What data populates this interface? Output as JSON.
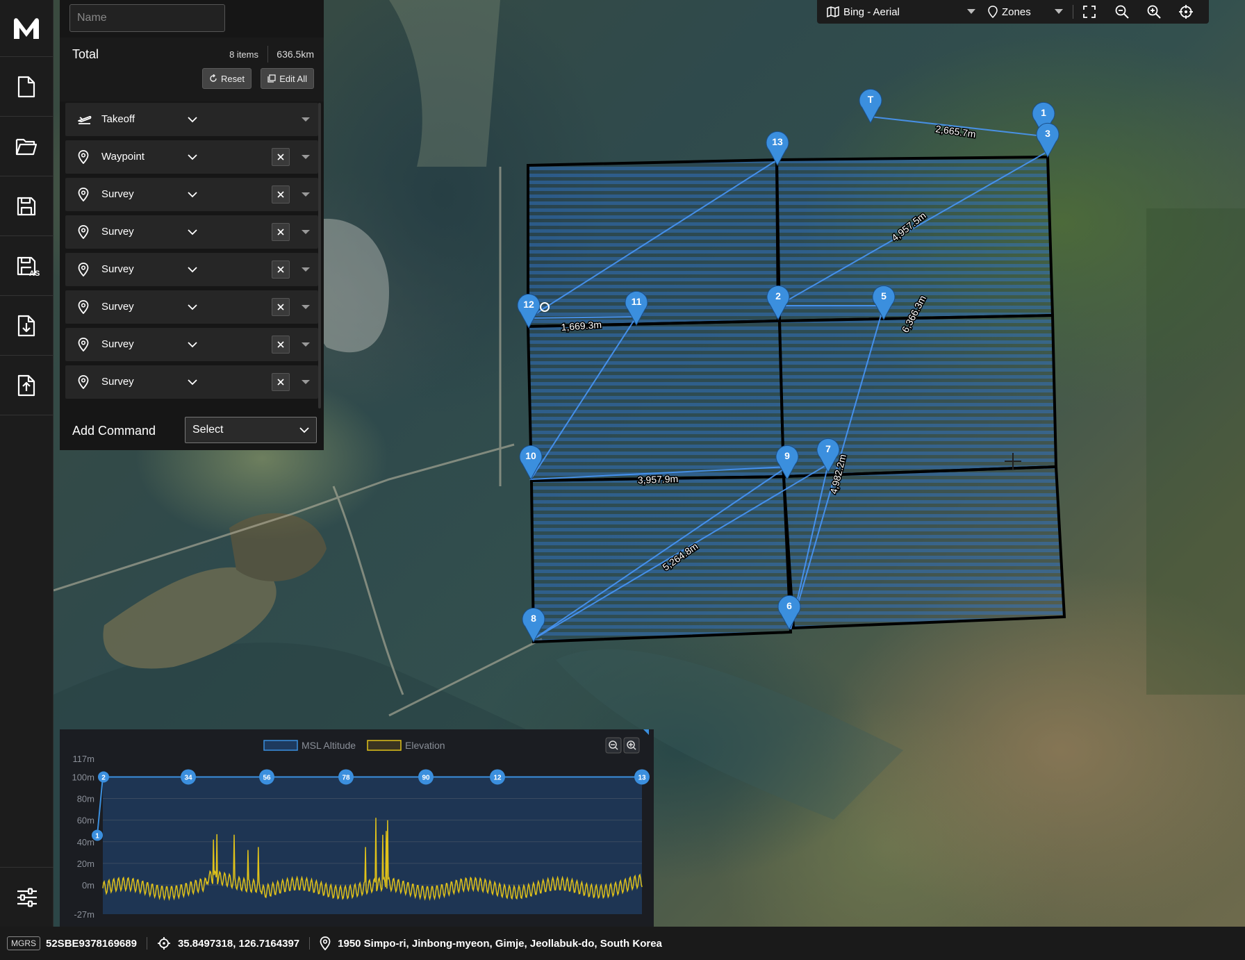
{
  "app": {
    "logo": "M"
  },
  "sidebar": {
    "items": [
      {
        "name": "new-file-icon"
      },
      {
        "name": "open-folder-icon"
      },
      {
        "name": "save-icon"
      },
      {
        "name": "save-as-icon",
        "badge": "AS"
      },
      {
        "name": "import-icon"
      },
      {
        "name": "export-icon"
      }
    ],
    "settings_icon": "sliders-icon"
  },
  "panel": {
    "name_placeholder": "Name",
    "total_label": "Total",
    "total_items": "8 items",
    "total_distance": "636.5km",
    "reset_label": "Reset",
    "edit_all_label": "Edit All",
    "commands": [
      {
        "label": "Takeoff",
        "icon": "takeoff-icon",
        "deletable": false
      },
      {
        "label": "Waypoint",
        "icon": "pin-icon",
        "deletable": true
      },
      {
        "label": "Survey",
        "icon": "pin-icon",
        "deletable": true
      },
      {
        "label": "Survey",
        "icon": "pin-icon",
        "deletable": true
      },
      {
        "label": "Survey",
        "icon": "pin-icon",
        "deletable": true
      },
      {
        "label": "Survey",
        "icon": "pin-icon",
        "deletable": true
      },
      {
        "label": "Survey",
        "icon": "pin-icon",
        "deletable": true
      },
      {
        "label": "Survey",
        "icon": "pin-icon",
        "deletable": true
      }
    ],
    "add_command_label": "Add Command",
    "add_command_select": "Select"
  },
  "toolbar": {
    "basemap": "Bing - Aerial",
    "zones": "Zones"
  },
  "map": {
    "markers": [
      "T",
      "1",
      "2",
      "3",
      "5",
      "6",
      "7",
      "8",
      "9",
      "10",
      "11",
      "12",
      "13"
    ],
    "distances": [
      "2,665.7m",
      "4,957.5m",
      "6,366.3m",
      "1,669.3m",
      "3,957.9m",
      "4,982.2m",
      "5,264.8m"
    ],
    "accent": "#3b8fde"
  },
  "elevation": {
    "legend": [
      "MSL Altitude",
      "Elevation"
    ],
    "y_ticks": [
      "117m",
      "100m",
      "80m",
      "60m",
      "40m",
      "20m",
      "0m",
      "-27m"
    ],
    "waypoints": [
      "1",
      "2",
      "34",
      "56",
      "78",
      "90",
      "12",
      "13"
    ],
    "colors": {
      "altitude": "#3b8fde",
      "elevation": "#e0c21a"
    }
  },
  "status": {
    "mgrs_label": "MGRS",
    "mgrs_value": "52SBE9378169689",
    "coords": "35.8497318, 126.7164397",
    "address": "1950 Simpo-ri, Jinbong-myeon, Gimje, Jeollabuk-do, South Korea"
  }
}
